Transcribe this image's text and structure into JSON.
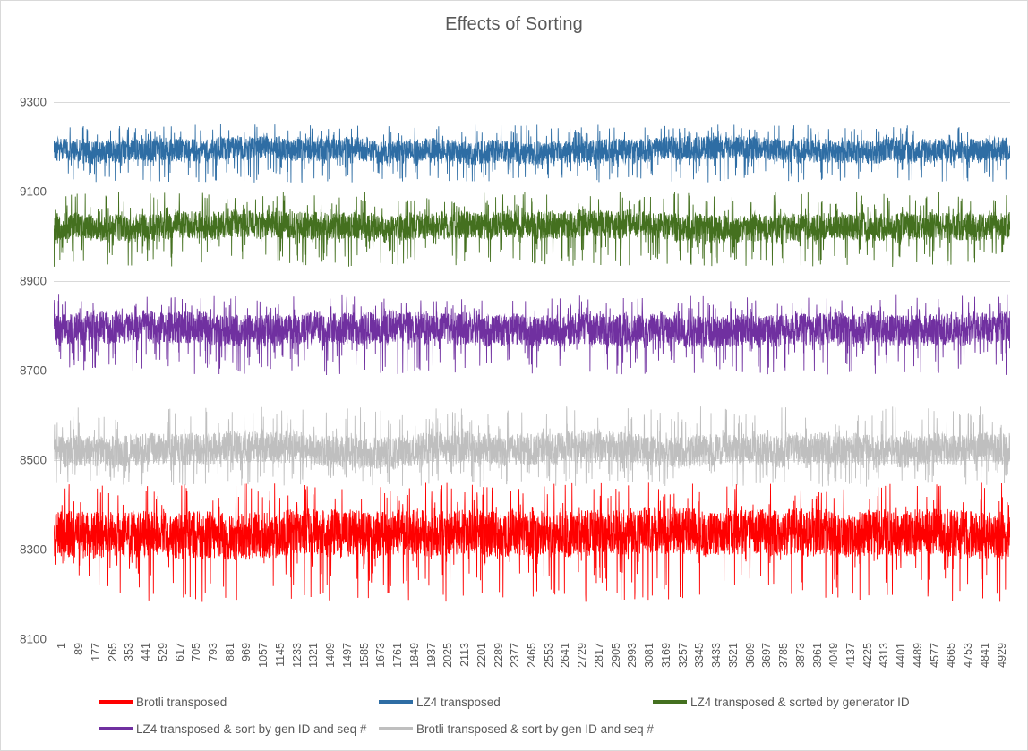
{
  "chart_data": {
    "type": "line",
    "title": "Effects of Sorting",
    "xlabel": "",
    "ylabel": "",
    "ylim": [
      8100,
      9300
    ],
    "yticks": [
      9300,
      9100,
      8900,
      8700,
      8500,
      8300,
      8100
    ],
    "grid": true,
    "legend_position": "bottom",
    "x_start": 1,
    "x_end": 4929,
    "x_tick_step": 88,
    "x_point_count": 4980,
    "xticks": [
      1,
      89,
      177,
      265,
      353,
      441,
      529,
      617,
      705,
      793,
      881,
      969,
      1057,
      1145,
      1233,
      1321,
      1409,
      1497,
      1585,
      1673,
      1761,
      1849,
      1937,
      2025,
      2113,
      2201,
      2289,
      2377,
      2465,
      2553,
      2641,
      2729,
      2817,
      2905,
      2993,
      3081,
      3169,
      3257,
      3345,
      3433,
      3521,
      3609,
      3697,
      3785,
      3873,
      3961,
      4049,
      4137,
      4225,
      4313,
      4401,
      4489,
      4577,
      4665,
      4753,
      4841,
      4929
    ],
    "series": [
      {
        "name": "Brotli transposed",
        "color": "#FF0000",
        "mean": 8330,
        "min": 8185,
        "max": 8450,
        "band_low": 8280,
        "band_high": 8390,
        "seed": 11
      },
      {
        "name": "LZ4 transposed",
        "color": "#2E6DA4",
        "mean": 9190,
        "min": 9120,
        "max": 9250,
        "band_low": 9165,
        "band_high": 9220,
        "seed": 23
      },
      {
        "name": "LZ4 transposed & sorted by generator ID",
        "color": "#44701F",
        "mean": 9020,
        "min": 8930,
        "max": 9100,
        "band_low": 8990,
        "band_high": 9055,
        "seed": 37
      },
      {
        "name": "LZ4 transposed & sort by gen ID and seq #",
        "color": "#7030A0",
        "mean": 8790,
        "min": 8690,
        "max": 8870,
        "band_low": 8755,
        "band_high": 8830,
        "seed": 51
      },
      {
        "name": "Brotli transposed & sort by gen ID and seq #",
        "color": "#BFBFBF",
        "mean": 8520,
        "min": 8440,
        "max": 8620,
        "band_low": 8485,
        "band_high": 8560,
        "seed": 67
      }
    ]
  },
  "legend": {
    "rows": [
      [
        {
          "label": "Brotli transposed",
          "color": "#FF0000",
          "left": 110
        },
        {
          "label": "LZ4 transposed",
          "color": "#2E6DA4",
          "left": 423
        },
        {
          "label": "LZ4 transposed & sorted by generator ID",
          "color": "#44701F",
          "left": 729
        }
      ],
      [
        {
          "label": "LZ4 transposed & sort by gen ID and seq #",
          "color": "#7030A0",
          "left": 110
        },
        {
          "label": "Brotli transposed & sort by gen ID and seq #",
          "color": "#BFBFBF",
          "left": 423
        }
      ]
    ]
  },
  "colors": {
    "text": "#595959",
    "gridline": "#D9D9D9",
    "background": "#FFFFFF",
    "border": "#D9D9D9"
  }
}
